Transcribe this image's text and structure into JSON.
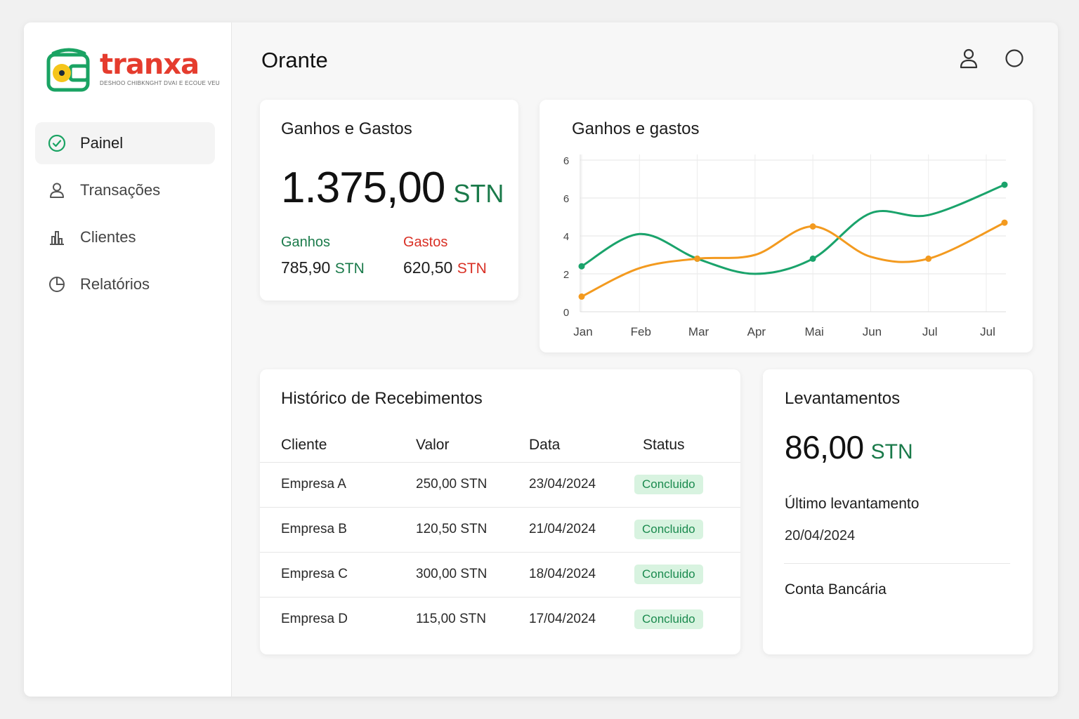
{
  "brand": {
    "name": "tranxa",
    "tagline": "DESHOO CHIBKNGHT DVAI E ECOUE VEU",
    "colors": {
      "green": "#1aa363",
      "red": "#e53c2e",
      "yellow": "#f5c51a"
    }
  },
  "sidebar": {
    "items": [
      {
        "label": "Painel",
        "icon": "check-circle-icon",
        "active": true
      },
      {
        "label": "Transações",
        "icon": "user-icon",
        "active": false
      },
      {
        "label": "Clientes",
        "icon": "bar-chart-icon",
        "active": false
      },
      {
        "label": "Relatórios",
        "icon": "pie-chart-icon",
        "active": false
      }
    ]
  },
  "header": {
    "title": "Orante",
    "icons": [
      "user-icon",
      "circle-icon"
    ]
  },
  "summary": {
    "title": "Ganhos e Gastos",
    "total_value": "1.375,00",
    "currency": "STN",
    "income_label": "Ganhos",
    "income_value": "785,90",
    "expense_label": "Gastos",
    "expense_value": "620,50"
  },
  "chart": {
    "title": "Ganhos e gastos",
    "colors": {
      "ganhos": "#1aa36b",
      "gastos": "#f39a1f"
    }
  },
  "chart_data": {
    "type": "line",
    "title": "Ganhos e gastos",
    "categories": [
      "Jan",
      "Feb",
      "Mar",
      "Apr",
      "Mai",
      "Jun",
      "Jul",
      "Jul"
    ],
    "y_tick_labels": [
      "0",
      "2",
      "4",
      "6",
      "6"
    ],
    "ylim": [
      0,
      8
    ],
    "grid": true,
    "series": [
      {
        "values": [
          2.4,
          4.1,
          2.8,
          2.0,
          2.8,
          5.2,
          5.1,
          6.7
        ]
      },
      {
        "values": [
          0.8,
          2.3,
          2.8,
          3.0,
          4.5,
          2.9,
          2.8,
          4.7
        ]
      }
    ]
  },
  "history": {
    "title": "Histórico de Recebimentos",
    "columns": [
      "Cliente",
      "Valor",
      "Data",
      "Status"
    ],
    "rows": [
      {
        "cliente": "Empresa A",
        "valor": "250,00 STN",
        "data": "23/04/2024",
        "status": "Concluido"
      },
      {
        "cliente": "Empresa B",
        "valor": "120,50 STN",
        "data": "21/04/2024",
        "status": "Concluido"
      },
      {
        "cliente": "Empresa C",
        "valor": "300,00 STN",
        "data": "18/04/2024",
        "status": "Concluido"
      },
      {
        "cliente": "Empresa D",
        "valor": "115,00 STN",
        "data": "17/04/2024",
        "status": "Concluido"
      }
    ]
  },
  "withdrawals": {
    "title": "Levantamentos",
    "value": "86,00",
    "currency": "STN",
    "last_label": "Último levantamento",
    "last_date": "20/04/2024",
    "account_label": "Conta Bancária"
  }
}
